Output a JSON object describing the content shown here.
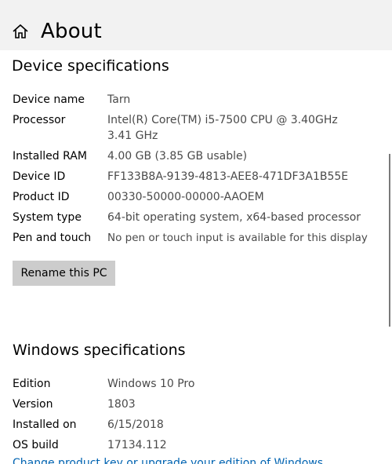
{
  "header": {
    "title": "About",
    "home_icon": "home-icon"
  },
  "device_specifications": {
    "title": "Device specifications",
    "rows": [
      {
        "label": "Device name",
        "value": "Tarn"
      },
      {
        "label": "Processor",
        "value": "Intel(R) Core(TM) i5-7500 CPU @ 3.40GHz   3.41 GHz"
      },
      {
        "label": "Installed RAM",
        "value": "4.00 GB (3.85 GB usable)"
      },
      {
        "label": "Device ID",
        "value": "FF133B8A-9139-4813-AEE8-471DF3A1B55E"
      },
      {
        "label": "Product ID",
        "value": "00330-50000-00000-AAOEM"
      },
      {
        "label": "System type",
        "value": "64-bit operating system, x64-based processor"
      },
      {
        "label": "Pen and touch",
        "value": "No pen or touch input is available for this display"
      }
    ],
    "rename_button": "Rename this PC"
  },
  "windows_specifications": {
    "title": "Windows specifications",
    "rows": [
      {
        "label": "Edition",
        "value": "Windows 10 Pro"
      },
      {
        "label": "Version",
        "value": "1803"
      },
      {
        "label": "Installed on",
        "value": "6/15/2018"
      },
      {
        "label": "OS build",
        "value": "17134.112"
      }
    ],
    "link": "Change product key or upgrade your edition of Windows"
  },
  "colors": {
    "header_bg": "#f2f2f2",
    "value_text": "#4a4a4a",
    "button_bg": "#cccccc",
    "link": "#0063b1"
  }
}
